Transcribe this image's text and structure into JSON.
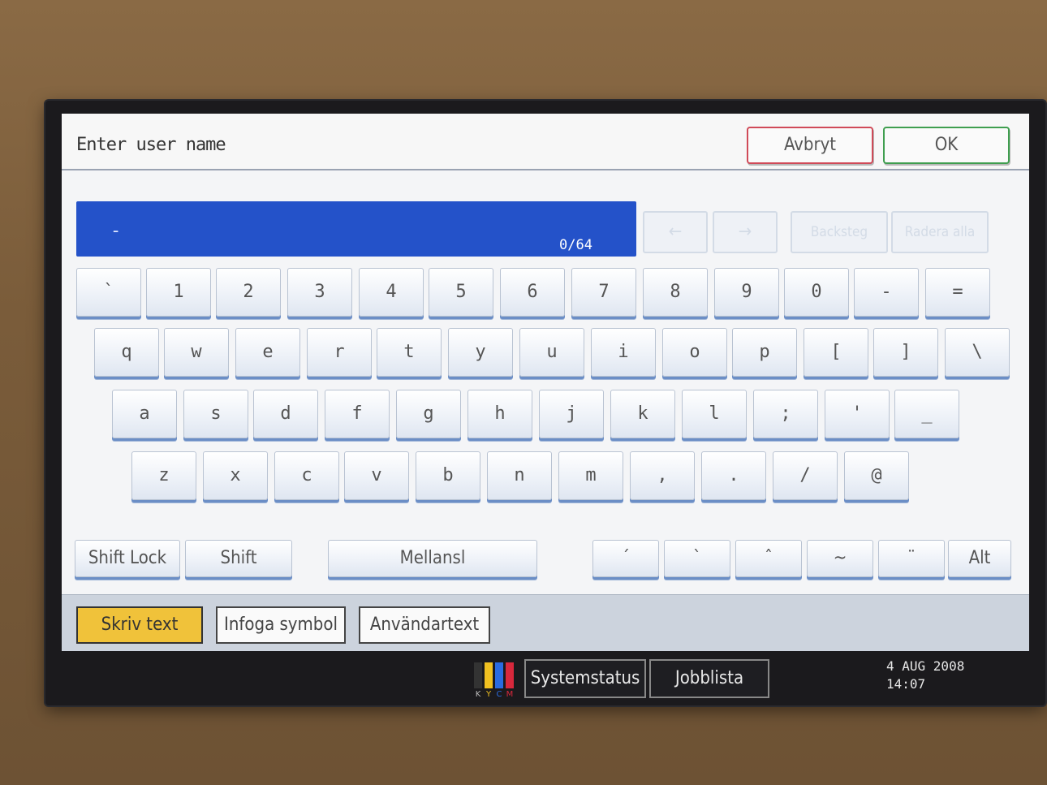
{
  "header": {
    "title": "Enter user name",
    "cancel_label": "Avbryt",
    "ok_label": "OK"
  },
  "input": {
    "value": "-",
    "counter": "0/64"
  },
  "edit_buttons": {
    "left_arrow": "←",
    "right_arrow": "→",
    "backspace": "Backsteg",
    "delete_all": "Radera alla"
  },
  "keyboard": {
    "row1": [
      "`",
      "1",
      "2",
      "3",
      "4",
      "5",
      "6",
      "7",
      "8",
      "9",
      "0",
      "-",
      "="
    ],
    "row2": [
      "q",
      "w",
      "e",
      "r",
      "t",
      "y",
      "u",
      "i",
      "o",
      "p",
      "[",
      "]",
      "\\"
    ],
    "row3": [
      "a",
      "s",
      "d",
      "f",
      "g",
      "h",
      "j",
      "k",
      "l",
      ";",
      "'",
      "_"
    ],
    "row4": [
      "z",
      "x",
      "c",
      "v",
      "b",
      "n",
      "m",
      ",",
      ".",
      "/",
      "@"
    ]
  },
  "modifiers": {
    "shift_lock": "Shift Lock",
    "shift": "Shift",
    "space": "Mellansl",
    "accents": [
      "´",
      "`",
      "ˆ",
      "~",
      "¨"
    ],
    "alt": "Alt"
  },
  "tabs": [
    "Skriv text",
    "Infoga symbol",
    "Användartext"
  ],
  "status": {
    "toner_letters": [
      "K",
      "Y",
      "C",
      "M"
    ],
    "toner_colors": [
      "#333333",
      "#f0c020",
      "#2a6be0",
      "#d8283c"
    ],
    "system_status": "Systemstatus",
    "job_list": "Jobblista",
    "date": "4 AUG  2008",
    "time": "14:07"
  }
}
